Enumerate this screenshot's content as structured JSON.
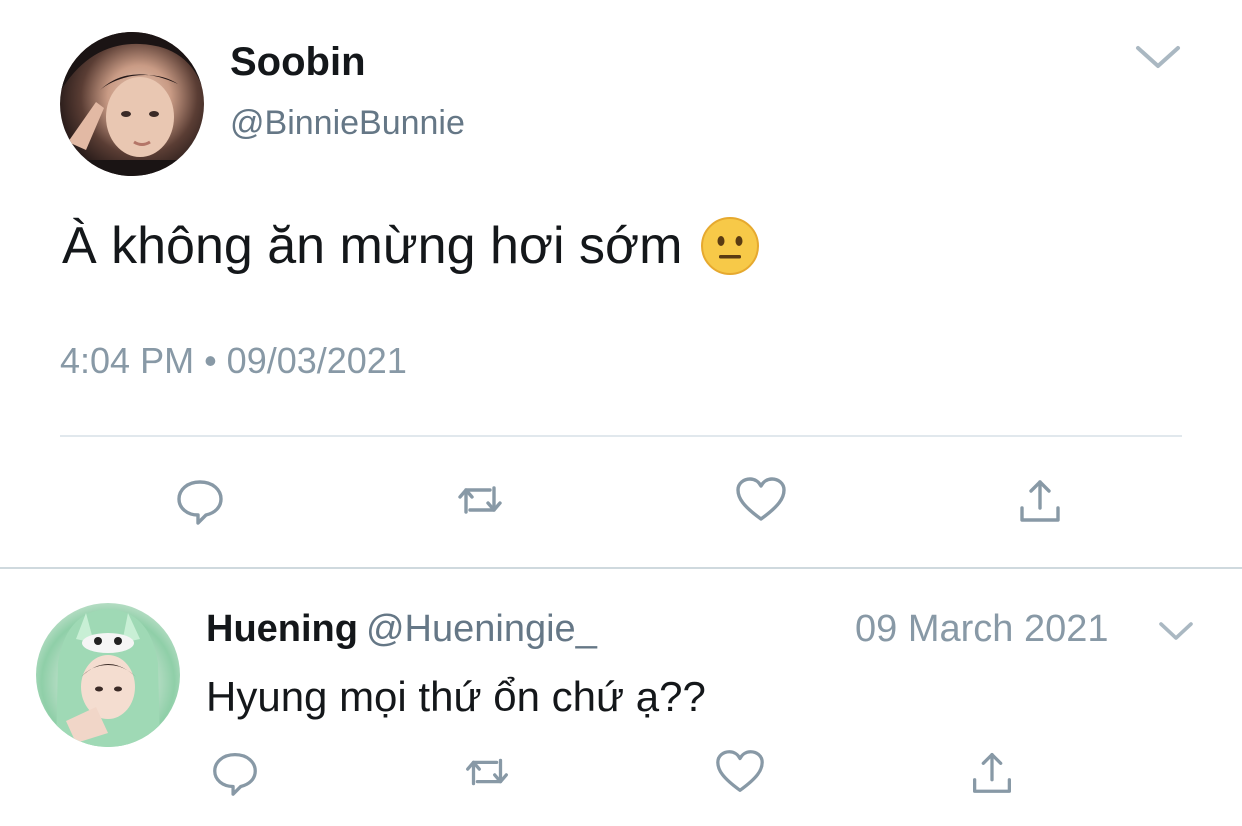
{
  "tweet": {
    "author": {
      "display_name": "Soobin",
      "handle": "@BinnieBunnie",
      "avatar_icon": "profile-photo"
    },
    "text": "À không ăn mừng hơi sớm",
    "emoji": "neutral-face-emoji",
    "timestamp": "4:04 PM • 09/03/2021",
    "actions": [
      "reply-icon",
      "retweet-icon",
      "like-icon",
      "share-icon"
    ],
    "menu_icon": "chevron-down-icon"
  },
  "reply": {
    "author": {
      "display_name": "Huening",
      "handle": "@Hueningie_",
      "avatar_icon": "profile-photo"
    },
    "date": "09 March 2021",
    "text": "Hyung mọi thứ ổn chứ ạ??",
    "actions": [
      "reply-icon",
      "retweet-icon",
      "like-icon",
      "share-icon"
    ],
    "menu_icon": "chevron-down-icon"
  },
  "colors": {
    "primary_text": "#14171a",
    "secondary_text": "#657786",
    "muted_text": "#8899a6",
    "divider": "#e1e8ed",
    "emoji_face": "#f7c948"
  }
}
